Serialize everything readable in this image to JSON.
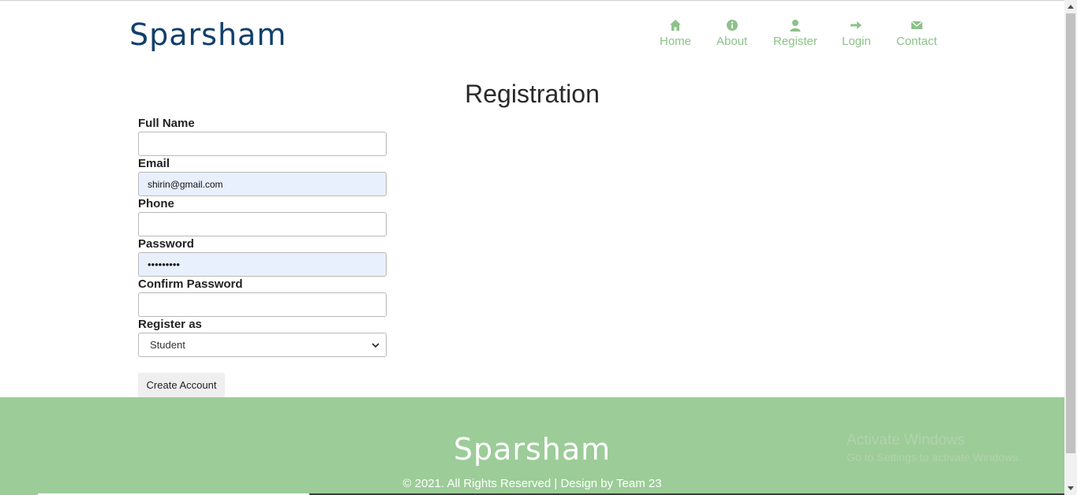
{
  "header": {
    "logo": "Sparsham",
    "nav": [
      {
        "label": "Home",
        "icon": "home-icon"
      },
      {
        "label": "About",
        "icon": "info-icon"
      },
      {
        "label": "Register",
        "icon": "user-icon"
      },
      {
        "label": "Login",
        "icon": "arrow-right-icon"
      },
      {
        "label": "Contact",
        "icon": "envelope-icon"
      }
    ]
  },
  "page": {
    "title": "Registration"
  },
  "form": {
    "full_name": {
      "label": "Full Name",
      "value": ""
    },
    "email": {
      "label": "Email",
      "value": "shirin@gmail.com"
    },
    "phone": {
      "label": "Phone",
      "value": ""
    },
    "password": {
      "label": "Password",
      "value": "•••••••••"
    },
    "confirm_password": {
      "label": "Confirm Password",
      "value": ""
    },
    "register_as": {
      "label": "Register as",
      "selected": "Student"
    },
    "submit_label": "Create Account"
  },
  "footer": {
    "logo": "Sparsham",
    "copyright": "© 2021. All Rights Reserved | Design by Team 23"
  },
  "watermark": {
    "title": "Activate Windows",
    "subtitle": "Go to Settings to activate Windows."
  },
  "colors": {
    "brand": "#123f6b",
    "nav": "#8dc28a",
    "footer_bg": "#9ccc98",
    "autofill": "#e8f0fe"
  }
}
